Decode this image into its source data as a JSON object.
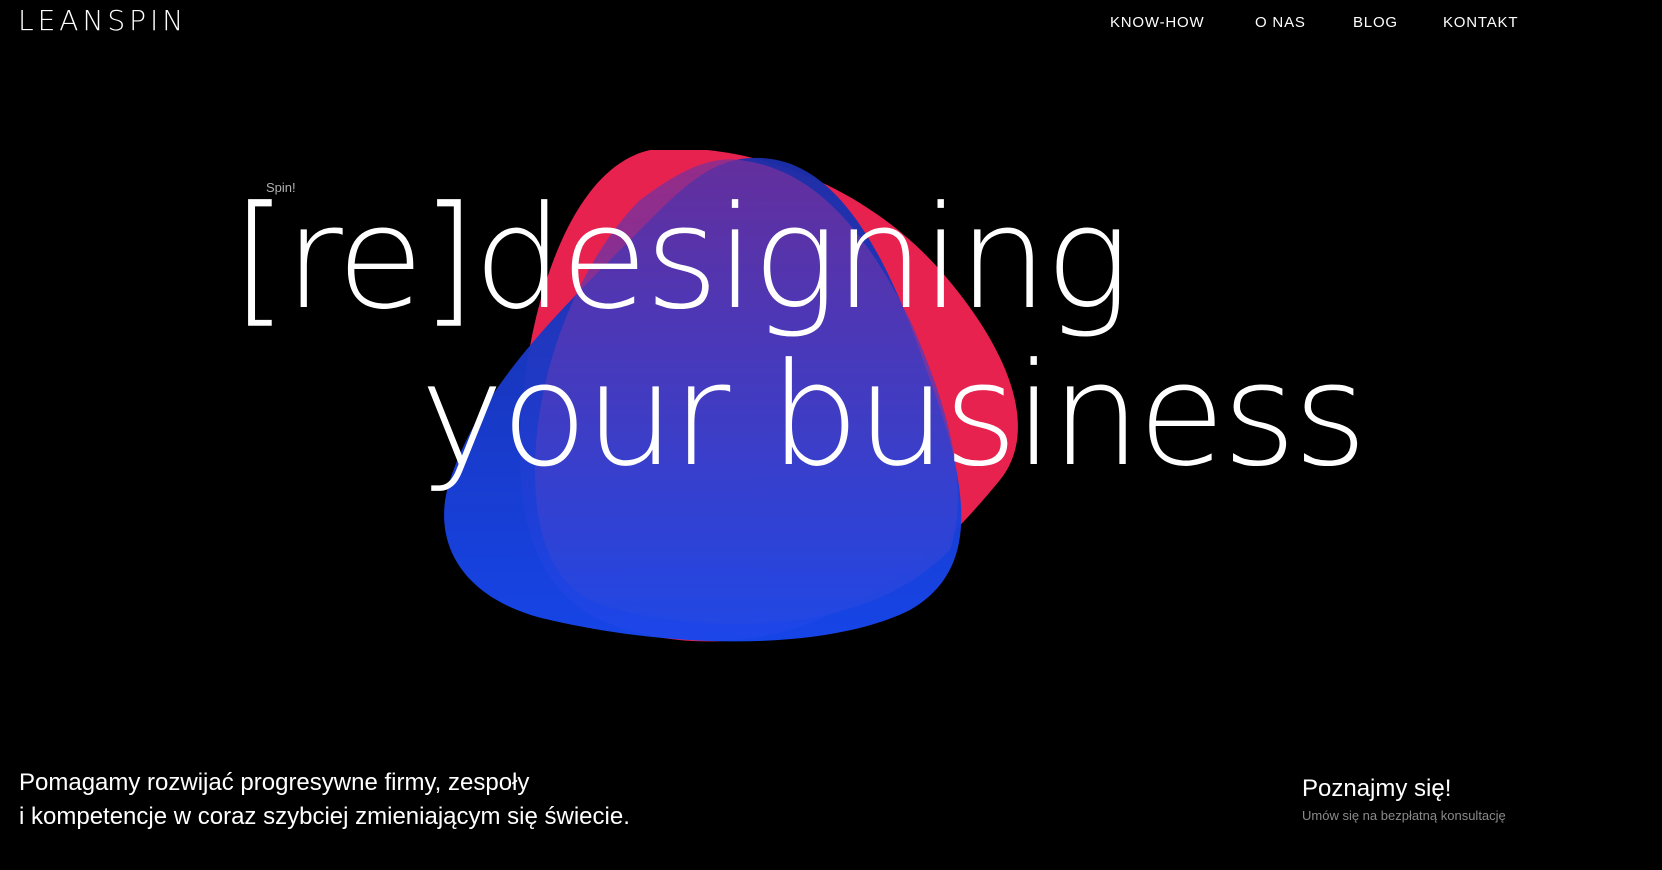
{
  "header": {
    "logo": "LEANSPIN",
    "nav": [
      {
        "label": "KNOW-HOW"
      },
      {
        "label": "O NAS"
      },
      {
        "label": "BLOG"
      },
      {
        "label": "KONTAKT"
      }
    ]
  },
  "hero": {
    "kicker": "Spin!",
    "headline_line1": "[re]designing",
    "headline_line2": "your business"
  },
  "footer": {
    "tagline_line1": "Pomagamy rozwijać progresywne firmy, zespoły",
    "tagline_line2": "i kompetencje w coraz szybciej zmieniającym się świecie.",
    "cta_title": "Poznajmy się!",
    "cta_subtitle": "Umów się na bezpłatną konsultację"
  },
  "colors": {
    "background": "#000000",
    "blob_red": "#e8224f",
    "blob_blue": "#1a3fe6",
    "blob_purple": "#6a35b0"
  }
}
